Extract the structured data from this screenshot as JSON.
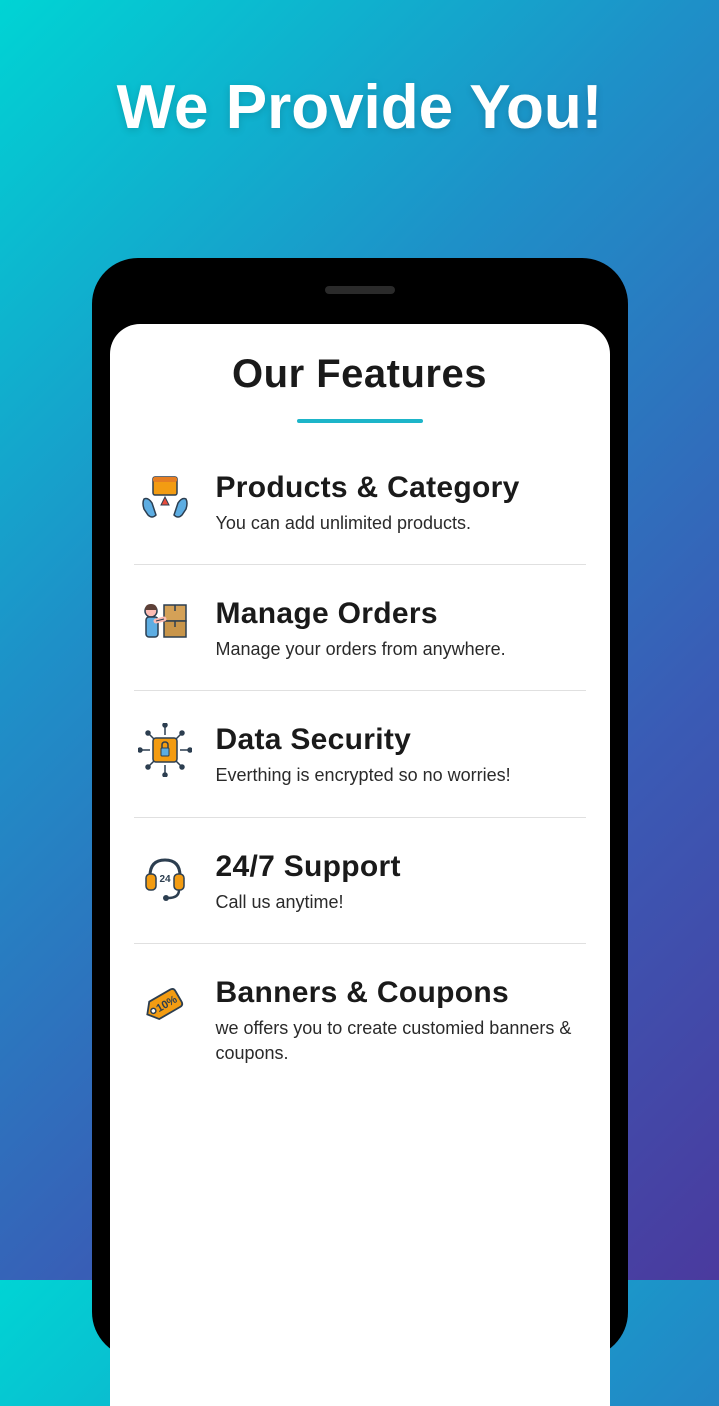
{
  "hero": {
    "title": "We Provide You!"
  },
  "section": {
    "title": "Our Features"
  },
  "features": [
    {
      "title": "Products & Category",
      "desc": "You can add unlimited products."
    },
    {
      "title": "Manage Orders",
      "desc": "Manage your orders from anywhere."
    },
    {
      "title": "Data Security",
      "desc": "Everthing is encrypted so no worries!"
    },
    {
      "title": "24/7 Support",
      "desc": "Call us anytime!"
    },
    {
      "title": "Banners & Coupons",
      "desc": "we offers you to create customied banners & coupons."
    }
  ]
}
